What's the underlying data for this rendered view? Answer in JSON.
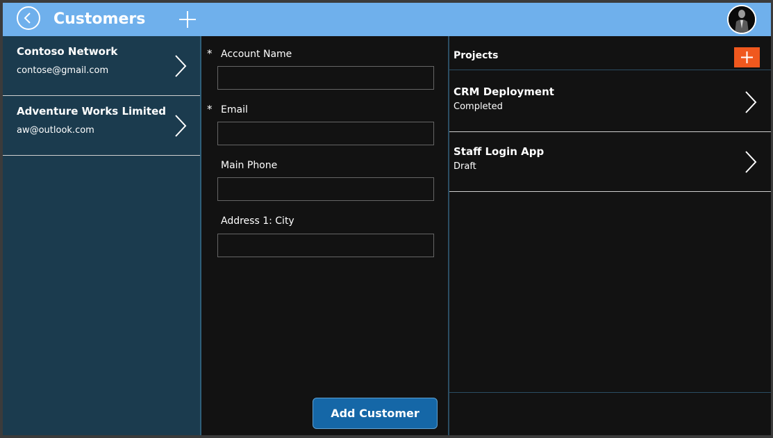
{
  "header": {
    "title": "Customers",
    "back_icon": "back-arrow-circle-icon",
    "add_icon": "plus-icon",
    "colors": {
      "bar": "#6fb0ec"
    }
  },
  "customers": [
    {
      "name": "Contoso Network",
      "email": "contose@gmail.com"
    },
    {
      "name": "Adventure Works Limited",
      "email": "aw@outlook.com"
    }
  ],
  "form": {
    "fields": [
      {
        "label": "Account Name",
        "required": "*",
        "value": ""
      },
      {
        "label": "Email",
        "required": "*",
        "value": ""
      },
      {
        "label": "Main Phone",
        "required": "",
        "value": ""
      },
      {
        "label": "Address 1: City",
        "required": "",
        "value": ""
      }
    ],
    "submit_label": "Add Customer"
  },
  "projects": {
    "title": "Projects",
    "items": [
      {
        "name": "CRM Deployment",
        "status": "Completed"
      },
      {
        "name": "Staff Login App",
        "status": "Draft"
      }
    ],
    "colors": {
      "add_button": "#f0581e"
    }
  }
}
